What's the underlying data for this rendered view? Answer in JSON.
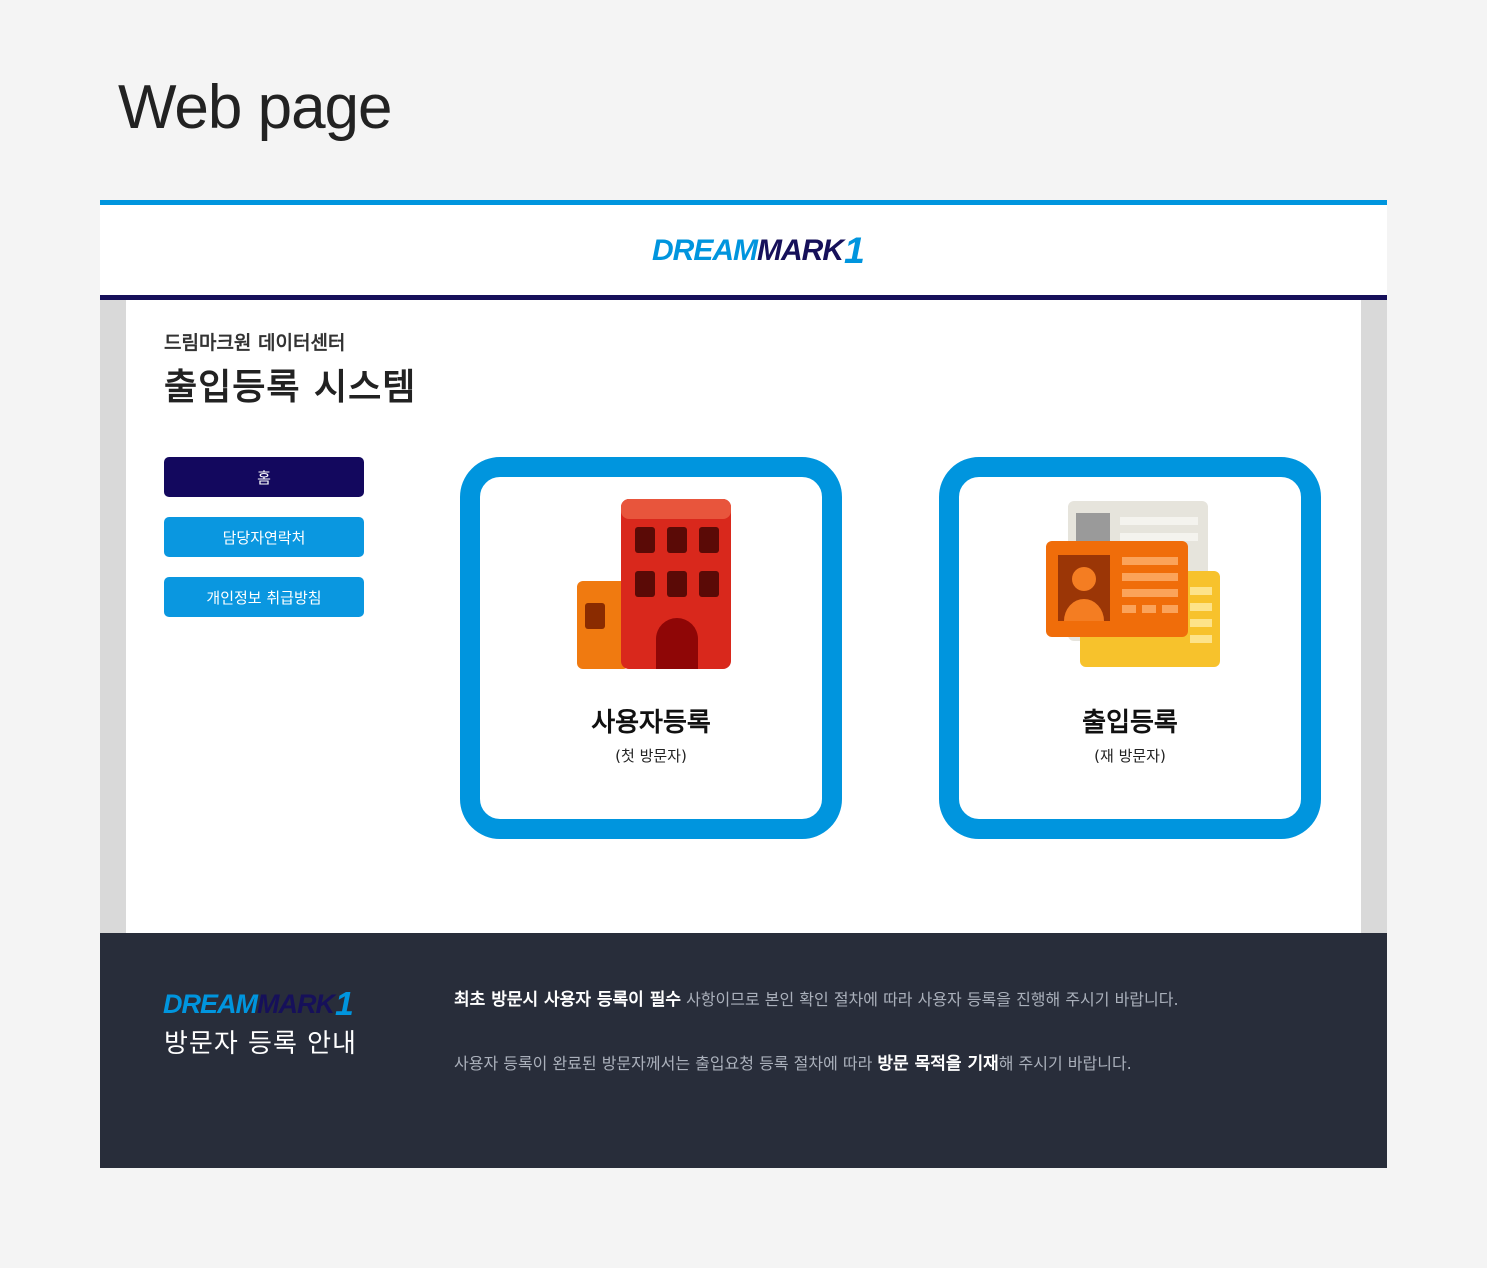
{
  "page_heading": "Web page",
  "logo": {
    "part1": "DREAM",
    "part2": "MARK",
    "part3": "1"
  },
  "content": {
    "subtitle": "드림마크원 데이터센터",
    "title": "출입등록 시스템"
  },
  "menu": [
    {
      "label": "홈",
      "active": true
    },
    {
      "label": "담당자연락처",
      "active": false
    },
    {
      "label": "개인정보 취급방침",
      "active": false
    }
  ],
  "cards": [
    {
      "title": "사용자등록",
      "subtitle": "(첫 방문자)",
      "icon": "building-icon"
    },
    {
      "title": "출입등록",
      "subtitle": "(재 방문자)",
      "icon": "id-card-icon"
    }
  ],
  "footer": {
    "title": "방문자 등록 안내",
    "notice1": {
      "bold": "최초 방문시 사용자 등록이 필수",
      "rest": " 사항이므로 본인 확인 절차에 따라 사용자 등록을 진행해 주시기 바랍니다."
    },
    "notice2": {
      "pre": "사용자 등록이 완료된 방문자께서는 출입요청 등록 절차에 따라 ",
      "bold": "방문 목적을 기재",
      "post": "해 주시기 바랍니다."
    }
  },
  "colors": {
    "accent": "#0095de",
    "navy": "#16105a",
    "footer_bg": "#282d3a"
  }
}
